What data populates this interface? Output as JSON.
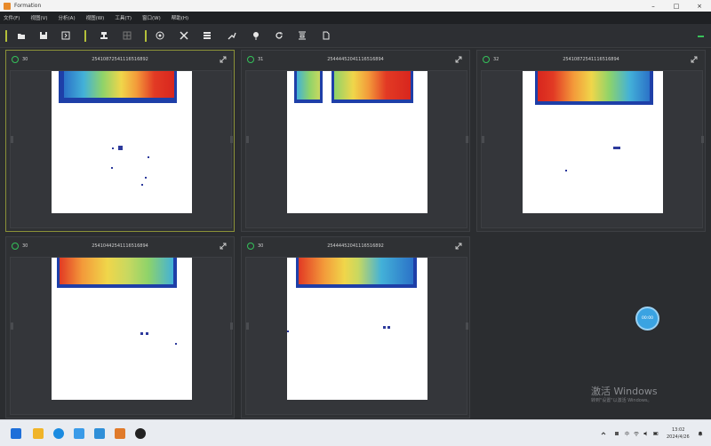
{
  "window": {
    "title": "Formation",
    "minimize": "–",
    "maximize": "□",
    "close": "×"
  },
  "menu": [
    "文件(F)",
    "视图(V)",
    "分析(A)",
    "视图(W)",
    "工具(T)",
    "窗口(W)",
    "帮助(H)"
  ],
  "toolbar": {
    "icons": [
      "folder-open-icon",
      "save-icon",
      "export-icon",
      "stamp-icon",
      "grid-icon",
      "target-icon",
      "crop-icon",
      "layers-icon",
      "chart-icon",
      "pin-icon",
      "refresh-icon",
      "filter-icon",
      "document-icon"
    ]
  },
  "panels": [
    {
      "num": "30",
      "id": "25410872541116516892",
      "selected": true
    },
    {
      "num": "31",
      "id": "25444452041116516894",
      "selected": false
    },
    {
      "num": "32",
      "id": "25410872541116516894",
      "selected": false
    },
    {
      "num": "30",
      "id": "25410442541116516894",
      "selected": false
    },
    {
      "num": "30",
      "id": "25444452041116516892",
      "selected": false
    }
  ],
  "fab": {
    "label": "00:00"
  },
  "watermark": {
    "title": "激活 Windows",
    "subtitle": "转到\"设置\"以激活 Windows。"
  },
  "taskbar": {
    "time": "13:02",
    "date": "2024/4/26",
    "lang": "中",
    "colors": [
      "#1e6fd9",
      "#f0b429",
      "#1b8be0",
      "#3a9be8",
      "#2f8fd8",
      "#e07a2a",
      "#222222"
    ]
  },
  "colors": {
    "accent_border": "#8b9138",
    "status_green": "#35c25a",
    "heat_red": "#e23a24",
    "heat_blue": "#1e3fa8",
    "fab_blue": "#3aa3e2"
  }
}
